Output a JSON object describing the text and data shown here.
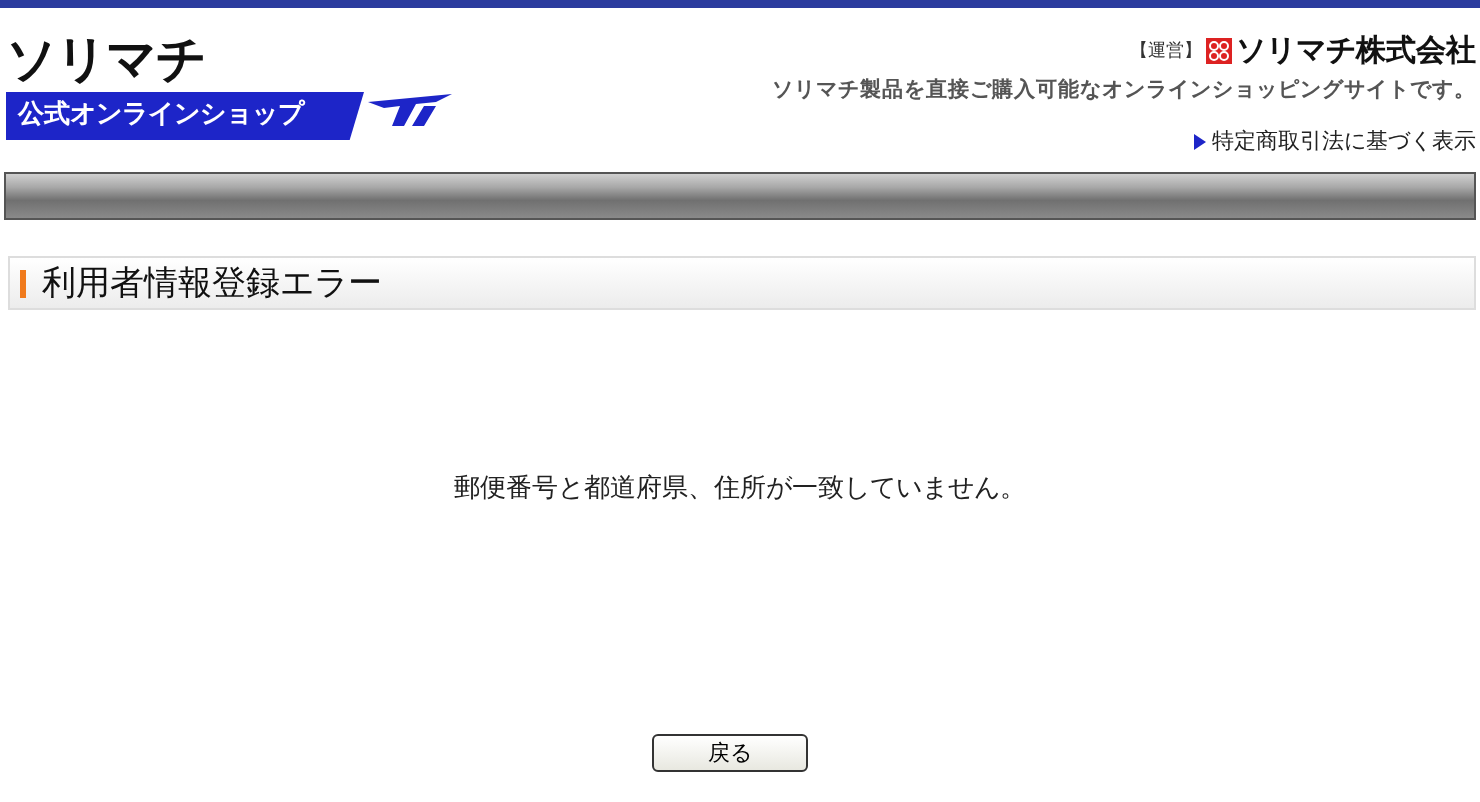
{
  "header": {
    "logo": "ソリマチ",
    "banner": "公式オンラインショップ",
    "operator_label": "【運営】",
    "operator_name": "ソリマチ株式会社",
    "tagline": "ソリマチ製品を直接ご購入可能なオンラインショッピングサイトです。",
    "link": "特定商取引法に基づく表示"
  },
  "page_title": "利用者情報登録エラー",
  "message": "郵便番号と都道府県、住所が一致していません。",
  "buttons": [
    "戻る"
  ]
}
